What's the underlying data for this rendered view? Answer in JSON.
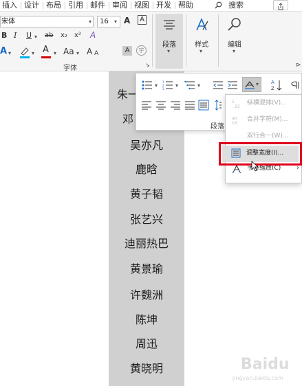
{
  "tabs": [
    "插入",
    "设计",
    "布局",
    "引用",
    "邮件",
    "审阅",
    "视图",
    "开发",
    "帮助"
  ],
  "search_label": "搜索",
  "ribbon": {
    "font_name": "宋体",
    "font_size": "16",
    "font_group_label": "字体",
    "paragraph_btn_label": "段落",
    "styles_btn_label": "样式",
    "edit_btn_label": "编辑",
    "styles_ab": "A",
    "subscript_symbol": "x₂",
    "superscript_symbol": "x²",
    "strike_symbol": "ab"
  },
  "paragraph_panel": {
    "label": "段落"
  },
  "context_menu": {
    "items": [
      {
        "label": "纵横混排(V)...",
        "disabled": true
      },
      {
        "label": "合并字符(M)...",
        "disabled": true
      },
      {
        "label": "双行合一(W)...",
        "disabled": true
      },
      {
        "label": "调整宽度(I)...",
        "disabled": false,
        "highlighted": true
      },
      {
        "label": "字符缩放(C)",
        "disabled": false,
        "has_submenu": true
      }
    ]
  },
  "document": {
    "names": [
      "朱一",
      "邓",
      "吴亦凡",
      "鹿晗",
      "黄子韬",
      "张艺兴",
      "迪丽热巴",
      "黄景瑜",
      "许魏洲",
      "陈坤",
      "周迅",
      "黄晓明"
    ]
  },
  "watermark": {
    "text": "Baidu",
    "url": "jingyan.baidu.com"
  },
  "colors": {
    "highlight_border": "#e0001a",
    "selection": "#d0d0d0",
    "font_color_red": "#d40000",
    "highlight_cyan": "#00b0f0"
  }
}
